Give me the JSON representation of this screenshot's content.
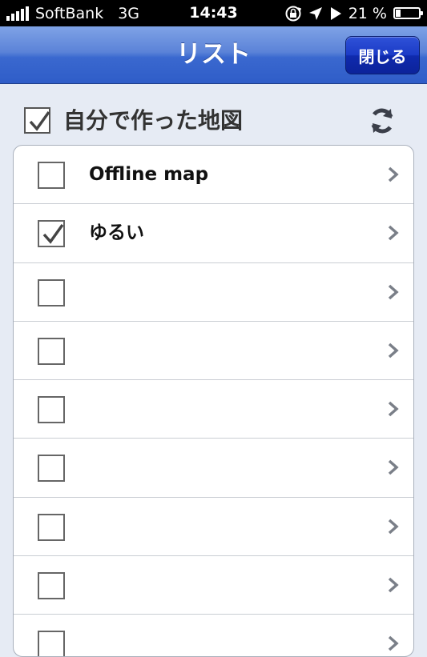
{
  "status_bar": {
    "carrier": "SoftBank",
    "network": "3G",
    "time": "14:43",
    "battery_percent_label": "21 %",
    "battery_level": 0.21,
    "icons": [
      "signal-icon",
      "rotation-lock-icon",
      "location-arrow-icon",
      "play-icon",
      "battery-icon"
    ]
  },
  "navbar": {
    "title": "リスト",
    "close_label": "閉じる"
  },
  "header": {
    "select_all_checked": true,
    "label": "自分で作った地図"
  },
  "list": {
    "items": [
      {
        "label": "Offline map",
        "checked": false
      },
      {
        "label": "ゆるい",
        "checked": true
      },
      {
        "label": "",
        "checked": false
      },
      {
        "label": "",
        "checked": false
      },
      {
        "label": "",
        "checked": false
      },
      {
        "label": "",
        "checked": false
      },
      {
        "label": "",
        "checked": false
      },
      {
        "label": "",
        "checked": false
      },
      {
        "label": "",
        "checked": false
      }
    ]
  },
  "colors": {
    "nav_blue": "#3a68cf",
    "button_blue": "#1b3bc6",
    "background": "#e6ebf4"
  }
}
